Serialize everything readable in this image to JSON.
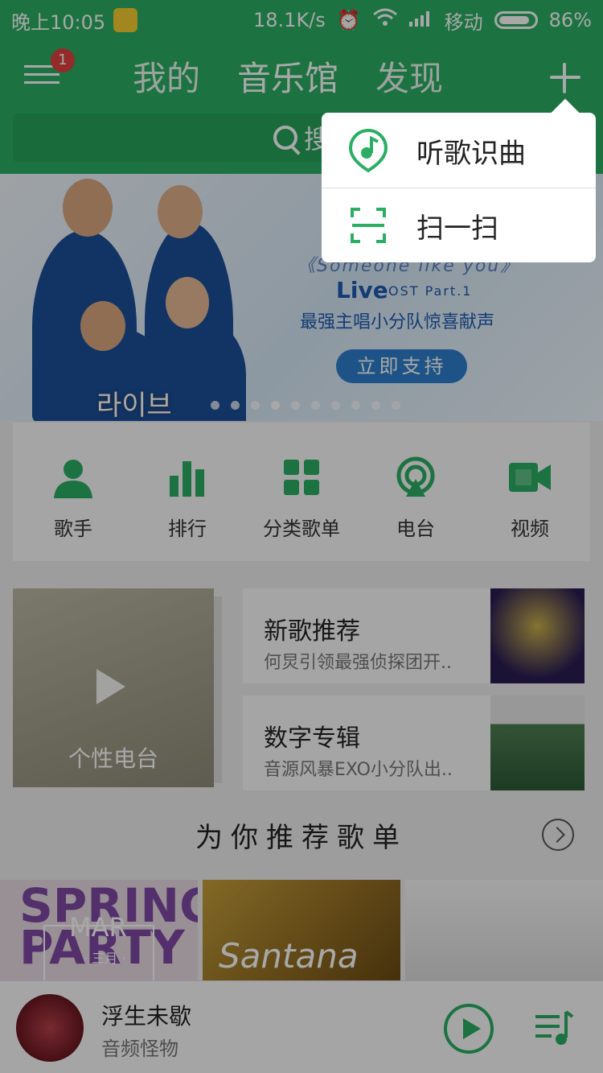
{
  "status_bar": {
    "time": "晚上10:05",
    "net_speed": "18.1K/s",
    "carrier": "移动",
    "battery": "86%"
  },
  "header": {
    "badge": "1",
    "tabs": [
      {
        "label": "我的"
      },
      {
        "label": "音乐馆"
      },
      {
        "label": "发现"
      }
    ],
    "search_placeholder": "搜"
  },
  "banner": {
    "subtitle": "《Someone like you》",
    "live": "Live",
    "ost": "OST  Part.1",
    "tagline": "最强主唱小分队惊喜献声",
    "button": "立即支持",
    "korean": "라이브",
    "dot_count": 10,
    "active_dot": 3
  },
  "quick_nav": [
    {
      "label": "歌手",
      "icon": "singer-icon"
    },
    {
      "label": "排行",
      "icon": "chart-icon"
    },
    {
      "label": "分类歌单",
      "icon": "category-icon"
    },
    {
      "label": "电台",
      "icon": "radio-icon"
    },
    {
      "label": "视频",
      "icon": "video-icon"
    }
  ],
  "radio_card": {
    "label": "个性电台"
  },
  "recommend": [
    {
      "title": "新歌推荐",
      "subtitle": "何炅引领最强侦探团开.."
    },
    {
      "title": "数字专辑",
      "subtitle": "音源风暴EXO小分队出.."
    }
  ],
  "playlist_section": {
    "title": "为你推荐歌单",
    "tiles": [
      {
        "art_text": "SPRING PARTY",
        "mar": "MAR",
        "month": "· 三月 ·"
      },
      {
        "art_text": "Santana"
      },
      {
        "art_text": ""
      }
    ]
  },
  "player": {
    "song": "浮生未歇",
    "artist": "音频怪物"
  },
  "popup_menu": [
    {
      "label": "听歌识曲",
      "icon": "music-recognize-icon"
    },
    {
      "label": "扫一扫",
      "icon": "scan-icon"
    }
  ],
  "colors": {
    "brand_green": "#2bae63",
    "overlay": "rgba(0,0,0,0.34)"
  }
}
